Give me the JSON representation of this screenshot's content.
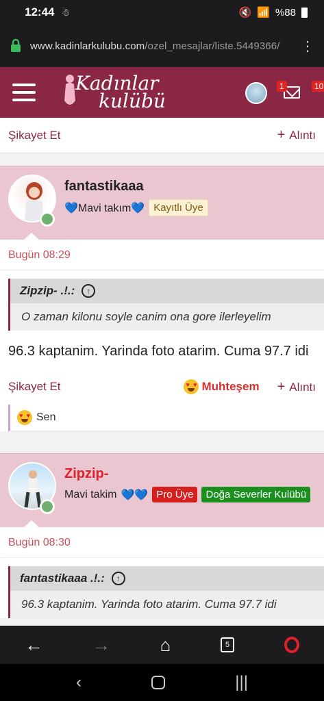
{
  "status": {
    "time": "12:44",
    "battery": "%88"
  },
  "browser": {
    "url_host": "www.kadinlarkulubu.com",
    "url_path": "/ozel_mesajlar/liste.5449366/"
  },
  "site": {
    "logo_line1": "Kadınlar",
    "logo_line2": "kulübü",
    "mail_badge": "1",
    "alerts_badge": "10"
  },
  "actions": {
    "report": "Şikayet Et",
    "quote": "Alıntı"
  },
  "post1": {
    "username": "fantastikaaa",
    "title": "💙Mavi takım💙",
    "badge": "Kayıtlı Üye",
    "date": "Bugün 08:29",
    "quote_author": "Zipzip- .!.:",
    "quote_text": "O zaman kilonu soyle canim ona gore ilerleyelim",
    "body": "96.3 kaptanim. Yarinda foto atarim. Cuma 97.7 idi",
    "reaction": "Muhteşem",
    "liked_by": "Sen"
  },
  "post2": {
    "username": "Zipzip-",
    "title": "Mavi takim",
    "title_hearts": "💙💙",
    "badge_pro": "Pro Üye",
    "badge_club": "Doğa Severler Kulübü",
    "date": "Bugün 08:30",
    "quote_author": "fantastikaaa .!.:",
    "quote_text": "96.3 kaptanim. Yarinda foto atarim. Cuma 97.7 idi"
  },
  "colors": {
    "brand": "#8a2744",
    "header_bg": "#e9c6d0",
    "date": "#c9505a"
  }
}
